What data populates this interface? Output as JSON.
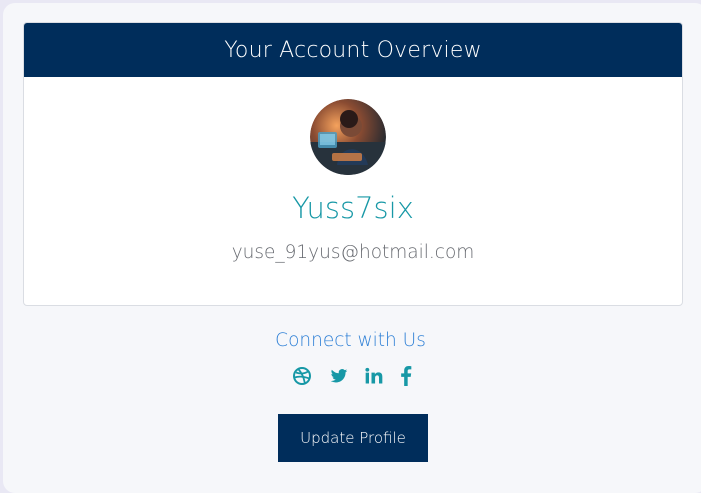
{
  "card": {
    "title": "Your Account Overview"
  },
  "profile": {
    "avatar_description": "avatar",
    "username": "Yuss7six",
    "email": "yuse_91yus@hotmail.com"
  },
  "social": {
    "title": "Connect with Us",
    "icons": [
      "dribbble-icon",
      "twitter-icon",
      "linkedin-icon",
      "facebook-icon"
    ]
  },
  "actions": {
    "update_label": "Update Profile"
  },
  "colors": {
    "header": "#002d5b",
    "username": "#1798a6",
    "email": "#676a70",
    "link": "#2f80d6",
    "social_icon": "#1798a6",
    "page_background": "#f6f7fa"
  }
}
